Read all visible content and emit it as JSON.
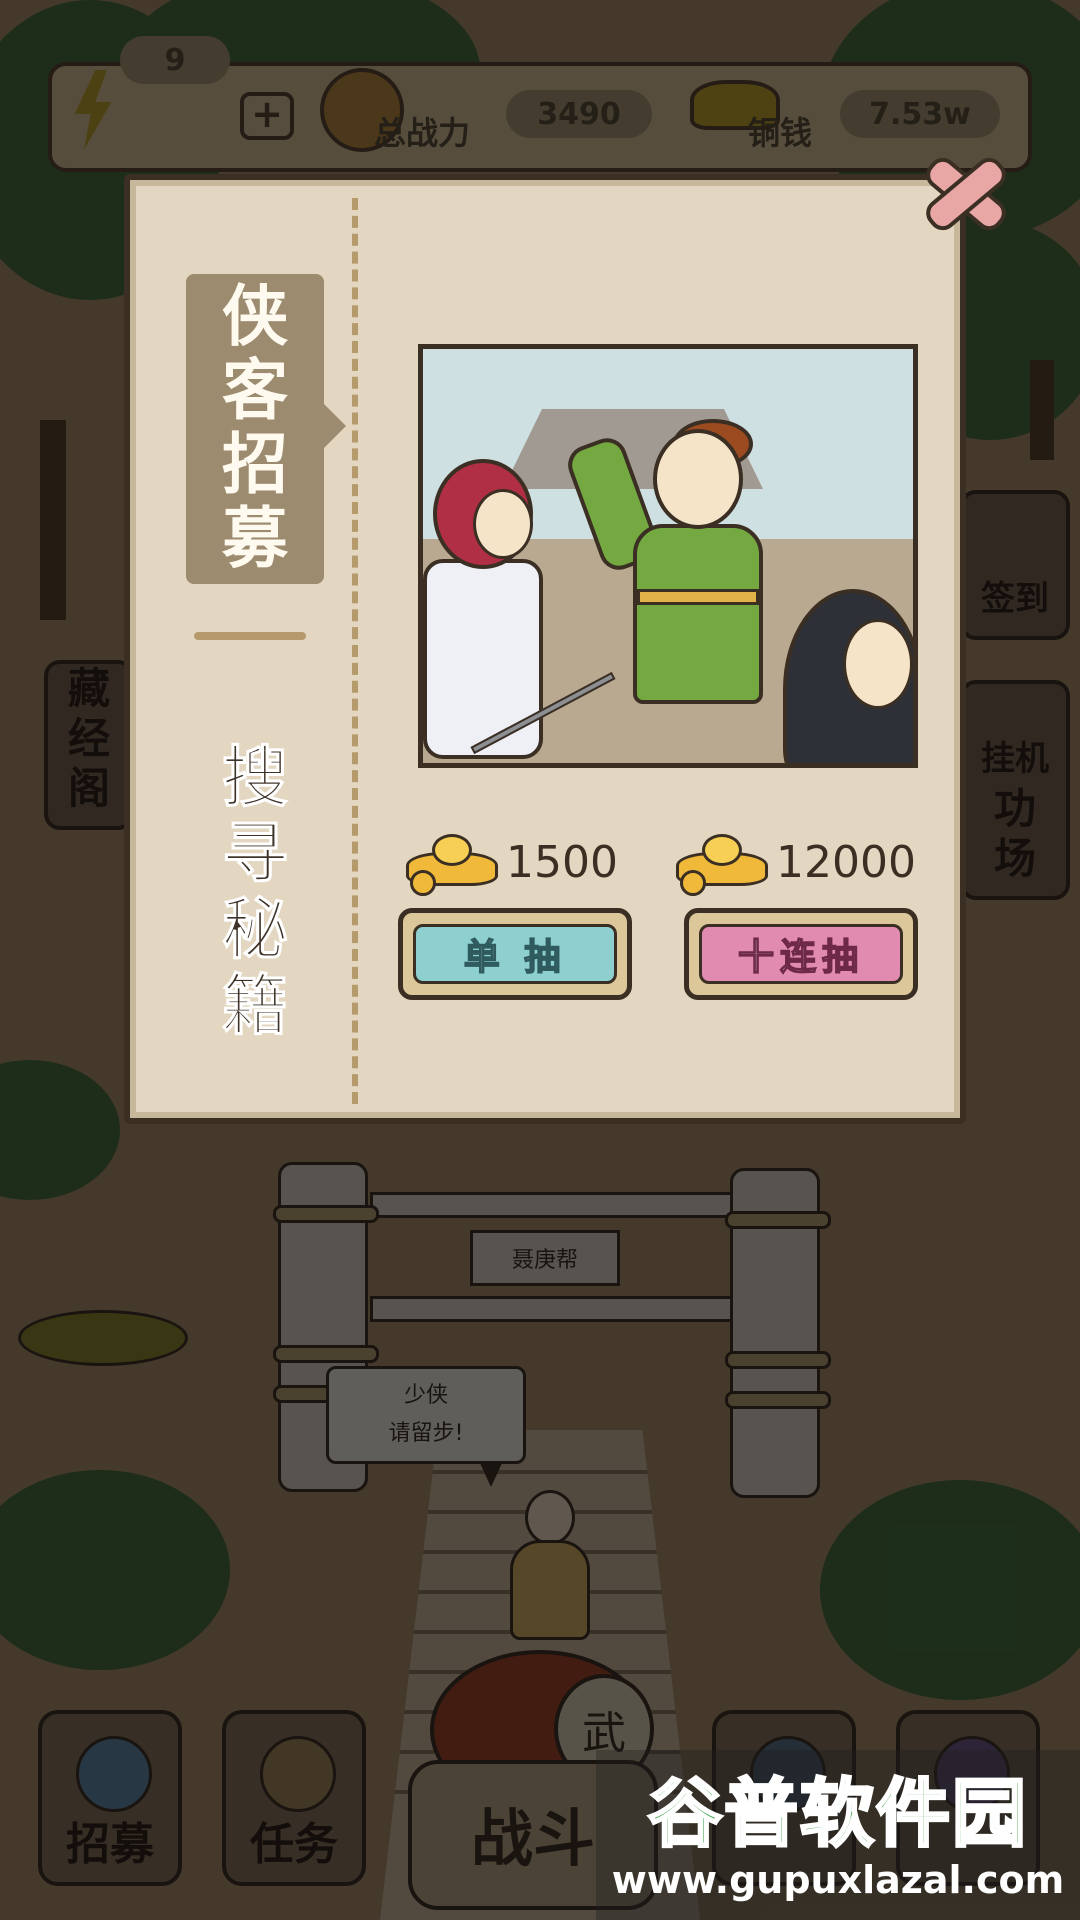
{
  "status_bar": {
    "energy": "9",
    "power_label": "总战力",
    "power_value": "3490",
    "coins_label": "铜钱",
    "coins_value": "7.53w"
  },
  "side_buttons": {
    "sign_in": "签到",
    "library": [
      "藏",
      "经",
      "阁"
    ],
    "idle": "挂机",
    "practice": [
      "功",
      "场"
    ]
  },
  "scene": {
    "gate_sign": "聂庚帮",
    "speech_lines": [
      "少侠",
      "请留步!"
    ],
    "drum_char": "武"
  },
  "modal": {
    "tab_recruit": [
      "侠",
      "客",
      "招",
      "募"
    ],
    "tab_search": [
      "搜",
      "寻",
      "秘",
      "籍"
    ],
    "single_cost": "1500",
    "ten_cost": "12000",
    "single_label": "单 抽",
    "ten_label": "十连抽"
  },
  "bottom_nav": {
    "recruit": "招募",
    "tasks": "任务",
    "battle": "战斗"
  },
  "watermark": {
    "title": "谷普软件园",
    "url": "www.gupuxlazal.com"
  }
}
